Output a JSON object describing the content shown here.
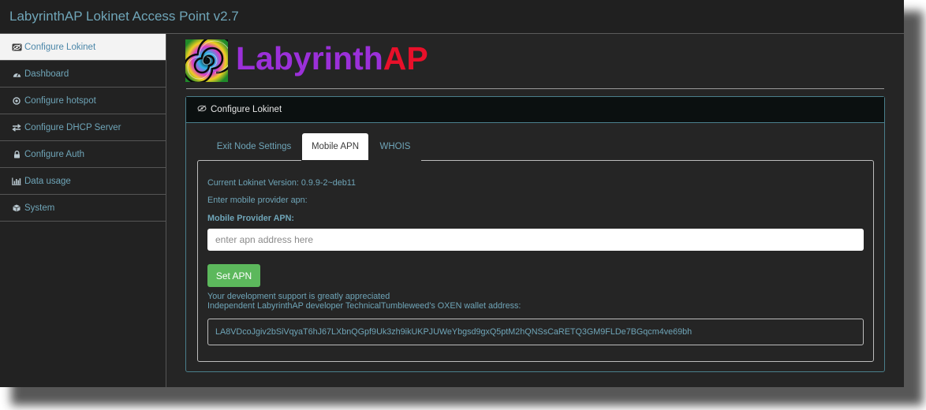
{
  "window": {
    "title": "LabyrinthAP Lokinet Access Point v2.7"
  },
  "sidebar": {
    "items": [
      {
        "label": "Configure Lokinet",
        "icon": "lokinet-eye-icon",
        "active": true
      },
      {
        "label": "Dashboard",
        "icon": "dashboard-gauge-icon",
        "active": false
      },
      {
        "label": "Configure hotspot",
        "icon": "hotspot-target-icon",
        "active": false
      },
      {
        "label": "Configure DHCP Server",
        "icon": "exchange-arrows-icon",
        "active": false
      },
      {
        "label": "Configure Auth",
        "icon": "lock-icon",
        "active": false
      },
      {
        "label": "Data usage",
        "icon": "bar-chart-icon",
        "active": false
      },
      {
        "label": "System",
        "icon": "cube-icon",
        "active": false
      }
    ]
  },
  "brand": {
    "part1": "Labyrinth",
    "part2": "AP",
    "color1": "#9b30d9",
    "color2": "#e8102a"
  },
  "card": {
    "title": "Configure Lokinet",
    "tabs": [
      {
        "label": "Exit Node Settings",
        "active": false
      },
      {
        "label": "Mobile APN",
        "active": true
      },
      {
        "label": "WHOIS",
        "active": false
      }
    ],
    "version_text": "Current Lokinet Version: 0.9.9-2~deb11",
    "prompt_text": "Enter mobile provider apn:",
    "field_label": "Mobile Provider APN:",
    "apn_placeholder": "enter apn address here",
    "apn_value": "",
    "set_button": "Set APN",
    "support_line1": "Your development support is greatly appreciated",
    "support_line2": "Independent LabyrinthAP developer TechnicalTumbleweed's OXEN wallet address:",
    "wallet_address": "LA8VDcoJgiv2bSiVqyaT6hJ67LXbnQGpf9Uk3zh9ikUKPJUWeYbgsd9gxQ5ptM2hQNSsCaRETQ3GM9FLDe7BGqcm4ve69bh"
  },
  "colors": {
    "accent_text": "#6fa5b8",
    "button_green": "#5cb85c",
    "card_border": "#4a7f8c"
  }
}
